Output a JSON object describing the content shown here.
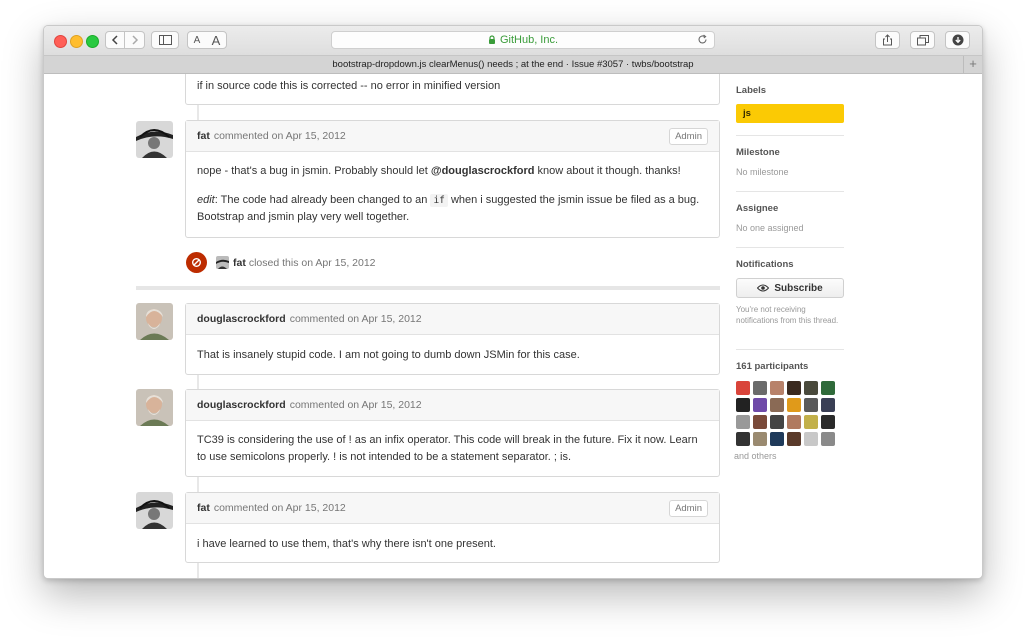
{
  "browser": {
    "address": "GitHub, Inc.",
    "tab_title": "bootstrap-dropdown.js clearMenus() needs ; at the end · Issue #3057 · twbs/bootstrap",
    "reader_small": "A",
    "reader_large": "A",
    "new_tab": "+"
  },
  "comments": [
    {
      "body": "if in source code this is corrected -- no error in minified version"
    },
    {
      "author": "fat",
      "meta": "commented on Apr 15, 2012",
      "badge": "Admin",
      "p1_before": "nope - that's a bug in jsmin. Probably should let ",
      "p1_mention": "@douglascrockford",
      "p1_after": " know about it though. thanks!",
      "p2_em": "edit",
      "p2_before": ": The code had already been changed to an ",
      "p2_code": "if",
      "p2_after": " when i suggested the jsmin issue be filed as a bug. Bootstrap and jsmin play very well together."
    },
    {
      "author": "douglascrockford",
      "meta": "commented on Apr 15, 2012",
      "body": "That is insanely stupid code. I am not going to dumb down JSMin for this case."
    },
    {
      "author": "douglascrockford",
      "meta": "commented on Apr 15, 2012",
      "body": "TC39 is considering the use of ! as an infix operator. This code will break in the future. Fix it now. Learn to use semicolons properly. ! is not intended to be a statement separator. ; is."
    },
    {
      "author": "fat",
      "meta": "commented on Apr 15, 2012",
      "badge": "Admin",
      "body": "i have learned to use them, that's why there isn't one present."
    }
  ],
  "event": {
    "actor": "fat",
    "text": "closed this on Apr 15, 2012"
  },
  "sidebar": {
    "labels_title": "Labels",
    "label": "js",
    "label_color": "#fbca04",
    "milestone_title": "Milestone",
    "milestone_value": "No milestone",
    "assignee_title": "Assignee",
    "assignee_value": "No one assigned",
    "notifications_title": "Notifications",
    "subscribe_label": "Subscribe",
    "notifications_text": "You're not receiving notifications from this thread.",
    "participants_title": "161 participants",
    "and_others": "and others"
  },
  "colors": {
    "closed_badge": "#bd2c00",
    "link_green": "#3a9c3a"
  }
}
